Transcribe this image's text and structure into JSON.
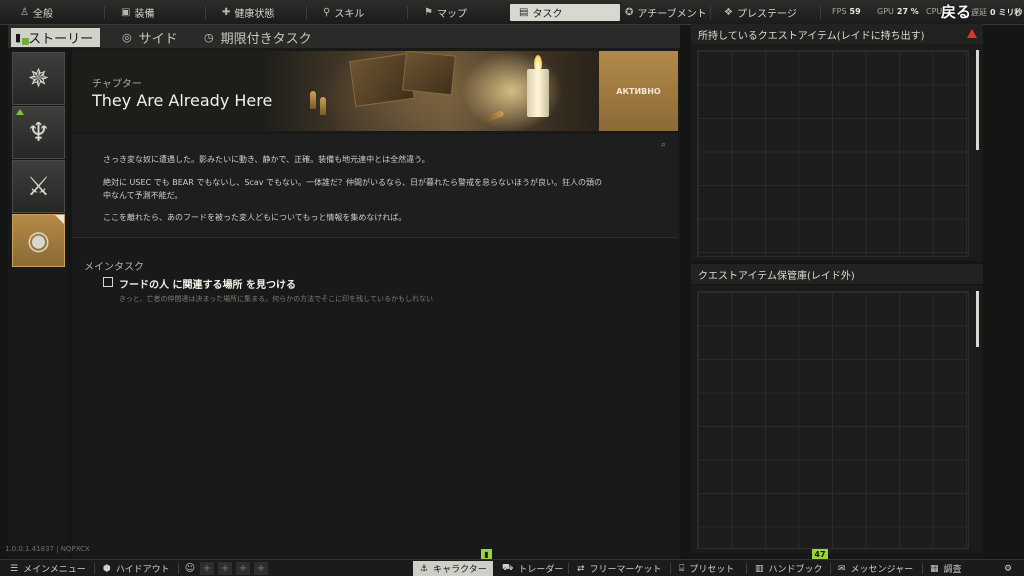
{
  "top_nav": {
    "tabs": [
      {
        "label": "全般",
        "icon": "person-icon"
      },
      {
        "label": "装備",
        "icon": "gear-equipment-icon"
      },
      {
        "label": "健康状態",
        "icon": "health-icon"
      },
      {
        "label": "スキル",
        "icon": "skills-icon"
      },
      {
        "label": "マップ",
        "icon": "map-pin-icon"
      },
      {
        "label": "タスク",
        "icon": "tasks-icon",
        "active": true
      },
      {
        "label": "アチーブメント",
        "icon": "achievement-icon"
      },
      {
        "label": "プレステージ",
        "icon": "prestige-icon"
      }
    ],
    "fps_label": "FPS",
    "fps_value": "59",
    "gpu_label": "GPU",
    "gpu_value": "27 %",
    "cpu_label": "CPU",
    "latency_label": "遅延",
    "latency_value": "0 ミリ秒",
    "back_label": "戻る"
  },
  "subtabs": [
    {
      "label": "ストーリー",
      "active": true
    },
    {
      "label": "サイド"
    },
    {
      "label": "期限付きタスク"
    }
  ],
  "sidebar": {
    "categories": [
      {
        "name": "compass-category",
        "icon": "compass-icon"
      },
      {
        "name": "flame-category",
        "icon": "flame-icon",
        "new": true
      },
      {
        "name": "axes-category",
        "icon": "crossed-axes-icon"
      },
      {
        "name": "globe-category",
        "icon": "globe-network-icon",
        "active": true
      }
    ]
  },
  "task": {
    "chapter_label": "チャプター",
    "title": "They Are Already Here",
    "status": "АКТИВНО",
    "description": [
      "さっき変な奴に遭遇した。影みたいに動き、静かで、正確。装備も地元連中とは全然違う。",
      "絶対に USEC でも BEAR でもないし、Scav でもない。一体誰だ？仲間がいるなら、日が暮れたら警戒を怠らないほうが良い。狂人の頭の",
      "中なんて予測不能だ。",
      "ここを離れたら、あのフードを被った変人どもについてもっと情報を集めなければ。"
    ],
    "main_tasks_heading": "メインタスク",
    "objective": "フードの人 に関連する場所 を見つける",
    "objective_sub": "きっと、亡者の仲間達は決まった場所に集まる。何らかの方法でそこに印を残しているかもしれない"
  },
  "right_panel": {
    "quest_items_title": "所持しているクエストアイテム(レイドに持ち出す)",
    "stash_title": "クエストアイテム保管庫(レイド外)"
  },
  "version": "1.0.0.1.41837 | NQPXCX",
  "bottom_nav": {
    "items": [
      {
        "label": "メインメニュー",
        "icon": "menu-icon"
      },
      {
        "label": "ハイドアウト",
        "icon": "hideout-icon"
      },
      {
        "label": "キャラクター",
        "icon": "character-icon",
        "active": true
      },
      {
        "label": "トレーダー",
        "icon": "cart-icon"
      },
      {
        "label": "フリーマーケット",
        "icon": "market-icon"
      },
      {
        "label": "プリセット",
        "icon": "preset-icon"
      },
      {
        "label": "ハンドブック",
        "icon": "handbook-icon"
      },
      {
        "label": "メッセンジャー",
        "icon": "messenger-icon"
      },
      {
        "label": "調査",
        "icon": "survey-icon"
      }
    ],
    "handbook_badge": "47",
    "colors": {
      "badge": "#9bd33a",
      "accent": "#b58a45",
      "warning": "#e0342c"
    }
  }
}
